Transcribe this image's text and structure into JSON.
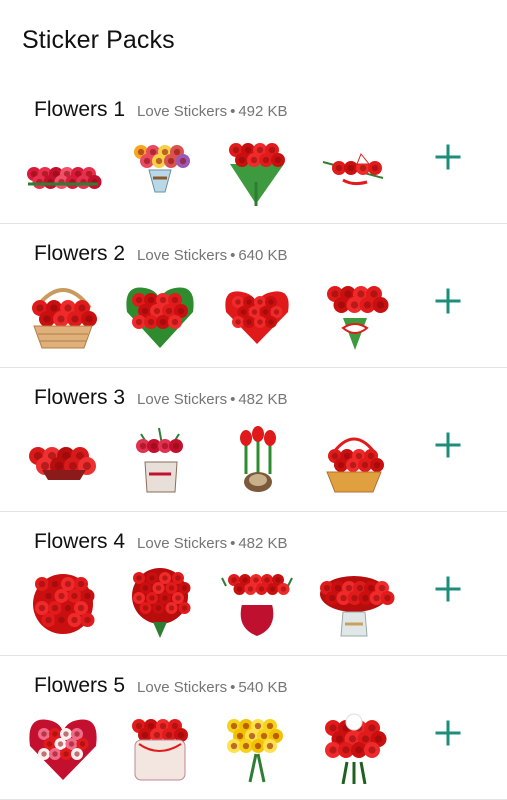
{
  "header": {
    "title": "Sticker Packs"
  },
  "colors": {
    "accent": "#1b8e7a",
    "meta": "#757575",
    "divider": "#e3e3e3",
    "rose": "#e01a1a",
    "leaf": "#2e8b2e"
  },
  "packs": [
    {
      "name": "Flowers 1",
      "publisher": "Love Stickers",
      "separator": "•",
      "size": "492 KB",
      "stickers": [
        "rose-row",
        "mixed-bouquet-vase",
        "rose-bouquet-greens",
        "scattered-roses"
      ]
    },
    {
      "name": "Flowers 2",
      "publisher": "Love Stickers",
      "separator": "•",
      "size": "640 KB",
      "stickers": [
        "rose-basket",
        "rose-heart-leaves",
        "rose-heart",
        "rose-bouquet-ribbon"
      ]
    },
    {
      "name": "Flowers 3",
      "publisher": "Love Stickers",
      "separator": "•",
      "size": "482 KB",
      "stickers": [
        "carnation-pile",
        "lily-box",
        "tulip-bulb",
        "basket-roses"
      ]
    },
    {
      "name": "Flowers 4",
      "publisher": "Love Stickers",
      "separator": "•",
      "size": "482 KB",
      "stickers": [
        "rose-ball",
        "rose-bouquet-large",
        "rose-vase-red",
        "rose-vase-glass"
      ]
    },
    {
      "name": "Flowers 5",
      "publisher": "Love Stickers",
      "separator": "•",
      "size": "540 KB",
      "stickers": [
        "rose-heart-pink",
        "rose-hatbox",
        "yellow-roses",
        "red-white-bouquet"
      ]
    }
  ],
  "add_icon": "plus-icon"
}
